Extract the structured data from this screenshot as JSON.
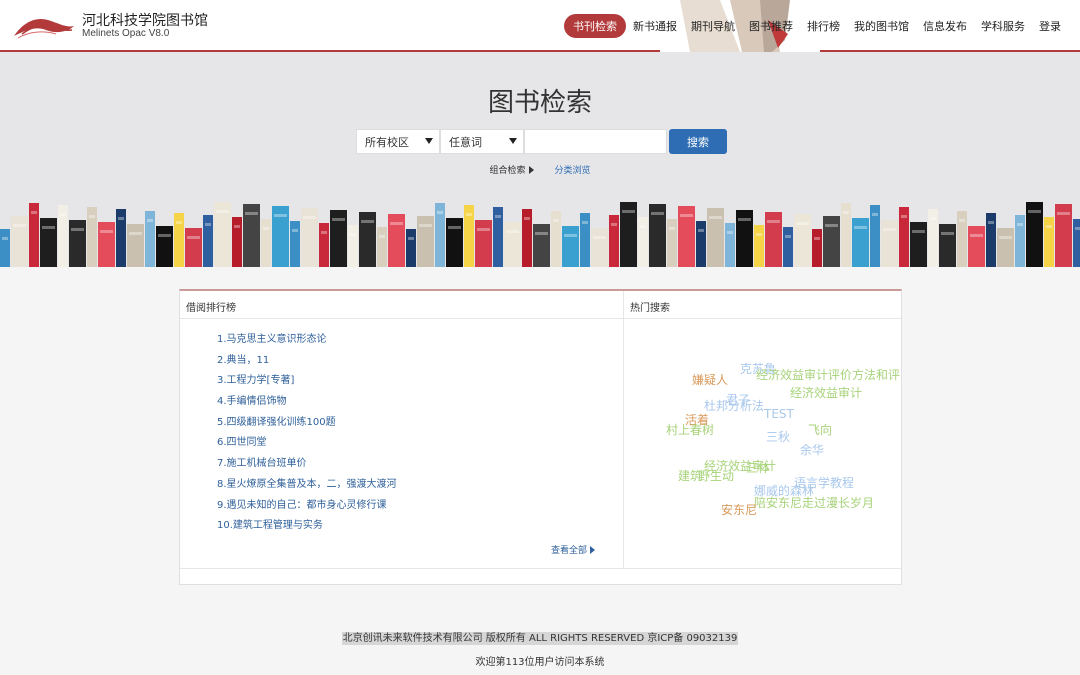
{
  "header": {
    "title": "河北科技学院图书馆",
    "subtitle": "Melinets Opac V8.0",
    "nav": [
      "书刊检索",
      "新书通报",
      "期刊导航",
      "图书推荐",
      "排行榜",
      "我的图书馆",
      "信息发布",
      "学科服务",
      "登录"
    ]
  },
  "search": {
    "title": "图书检索",
    "campus": "所有校区",
    "field": "任意词",
    "query": "",
    "button": "搜索",
    "combo_link": "组合检索",
    "browse_link": "分类浏览"
  },
  "ranking": {
    "title": "借阅排行榜",
    "items": [
      "1.马克思主义意识形态论",
      "2.典当，11",
      "3.工程力学[专著]",
      "4.手编情侣饰物",
      "5.四级翻译强化训练100题",
      "6.四世同堂",
      "7.施工机械台班单价",
      "8.星火燎原全集普及本，二，强渡大渡河",
      "9.遇见未知的自己：都市身心灵修行课",
      "10.建筑工程管理与实务"
    ],
    "view_all": "查看全部"
  },
  "hot_search": {
    "title": "热门搜索",
    "tags": [
      {
        "text": "克苏鲁",
        "color": "#a9c8ec"
      },
      {
        "text": "嫌疑人",
        "color": "#d99a5a"
      },
      {
        "text": "经济效益审计评价方法和评",
        "color": "#a7d37a"
      },
      {
        "text": "经济效益审计",
        "color": "#a7d37a"
      },
      {
        "text": "君子",
        "color": "#a9c8ec"
      },
      {
        "text": "杜邦分析法",
        "color": "#a9c8ec"
      },
      {
        "text": "TEST",
        "color": "#a9c8ec"
      },
      {
        "text": "活着",
        "color": "#d99a5a"
      },
      {
        "text": "村上春树",
        "color": "#a7d37a"
      },
      {
        "text": "飞向",
        "color": "#a7d37a"
      },
      {
        "text": "三秋",
        "color": "#a9c8ec"
      },
      {
        "text": "余华",
        "color": "#a9c8ec"
      },
      {
        "text": "经济效益审计",
        "color": "#a7d37a"
      },
      {
        "text": "三体",
        "color": "#a7d37a"
      },
      {
        "text": "建筑",
        "color": "#a7d37a"
      },
      {
        "text": "野生动",
        "color": "#a7d37a"
      },
      {
        "text": "语言学教程",
        "color": "#a9c8ec"
      },
      {
        "text": "娜威的森林",
        "color": "#a9c8ec"
      },
      {
        "text": "陪安东尼走过漫长岁月",
        "color": "#a7d37a"
      },
      {
        "text": "安东尼",
        "color": "#d99a5a"
      }
    ]
  },
  "footer": {
    "copyright": "北京创讯未来软件技术有限公司 版权所有 ALL RIGHTS RESERVED 京ICP备 09032139",
    "visit": "欢迎第113位用户访问本系统"
  },
  "colors": {
    "brand_red": "#b23a3a",
    "accent_blue": "#2e6db4"
  }
}
